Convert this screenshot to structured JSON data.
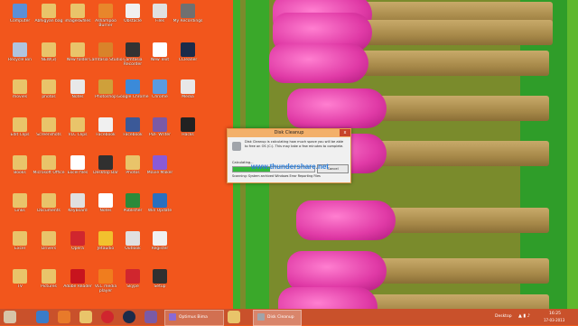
{
  "desktop": {
    "icons": [
      {
        "label": "Computer",
        "color": "#5a8fd6"
      },
      {
        "label": "Abhigyan bag",
        "color": "#e9c46a"
      },
      {
        "label": "images&files",
        "color": "#e9c46a"
      },
      {
        "label": "Ashampoo Burner",
        "color": "#e8862b"
      },
      {
        "label": "Obstacle",
        "color": "#f0f0f0"
      },
      {
        "label": "Files",
        "color": "#e0e0e0"
      },
      {
        "label": "My Recordings",
        "color": "#707070"
      },
      {
        "label": "Recycle Bin",
        "color": "#b0c4de"
      },
      {
        "label": "NEW(3)",
        "color": "#e9c46a"
      },
      {
        "label": "New folder",
        "color": "#e9c46a"
      },
      {
        "label": "Camtasia Studio",
        "color": "#d9832a"
      },
      {
        "label": "Camtasia Recorder",
        "color": "#333333"
      },
      {
        "label": "New Text",
        "color": "#ffffff"
      },
      {
        "label": "CCleaner",
        "color": "#1c2b4a"
      },
      {
        "label": "movies",
        "color": "#e9c46a"
      },
      {
        "label": "photos",
        "color": "#e9c46a"
      },
      {
        "label": "Notes",
        "color": "#e8e8e8"
      },
      {
        "label": "Photoshop",
        "color": "#cfa03a"
      },
      {
        "label": "Google Chrome",
        "color": "#3b8ad9"
      },
      {
        "label": "Chrome",
        "color": "#5b9be0"
      },
      {
        "label": "Media",
        "color": "#e8e8e8"
      },
      {
        "label": "Edit Clips",
        "color": "#e9c46a"
      },
      {
        "label": "Screenshots",
        "color": "#e9c46a"
      },
      {
        "label": "VLC Clips",
        "color": "#e9c46a"
      },
      {
        "label": "Facebook",
        "color": "#f0f0f0"
      },
      {
        "label": "Facebook",
        "color": "#3b5998"
      },
      {
        "label": "PDF Writer",
        "color": "#7b5aa6"
      },
      {
        "label": "Hacks",
        "color": "#222222"
      },
      {
        "label": "Books",
        "color": "#e9c46a"
      },
      {
        "label": "Microsoft Office",
        "color": "#e9c46a"
      },
      {
        "label": "Excel files",
        "color": "#ffffff"
      },
      {
        "label": "Desktop Bar",
        "color": "#303030"
      },
      {
        "label": "Photos",
        "color": "#e9c46a"
      },
      {
        "label": "Movie Maker",
        "color": "#8a5ad6"
      },
      {
        "label": "Links",
        "color": "#e9c46a"
      },
      {
        "label": "Documents",
        "color": "#e9c46a"
      },
      {
        "label": "Keyboard",
        "color": "#e0e0e0"
      },
      {
        "label": "Notes",
        "color": "#ffffff"
      },
      {
        "label": "Publisher",
        "color": "#2a8a3a"
      },
      {
        "label": "Win Update",
        "color": "#2a6fbf"
      },
      {
        "label": "Excel",
        "color": "#e9c46a"
      },
      {
        "label": "Drivers",
        "color": "#e9c46a"
      },
      {
        "label": "Opera",
        "color": "#d0262e"
      },
      {
        "label": "Jetaudio",
        "color": "#f2c12e"
      },
      {
        "label": "Outlook",
        "color": "#e0e0e0"
      },
      {
        "label": "Register",
        "color": "#f0f0f0"
      },
      {
        "label": "TV",
        "color": "#e9c46a"
      },
      {
        "label": "Pictures",
        "color": "#e9c46a"
      },
      {
        "label": "Adobe Reader",
        "color": "#c8141e"
      },
      {
        "label": "VLC media player",
        "color": "#f07d1e"
      },
      {
        "label": "Skype",
        "color": "#d0262e"
      },
      {
        "label": "Setup",
        "color": "#303030"
      }
    ]
  },
  "dialog": {
    "title": "Disk Cleanup",
    "close": "x",
    "message": "Disk Cleanup is calculating how much space you will be able to free on OS (C:). This may take a few minutes to complete.",
    "calculating": "Calculating...",
    "cancel": "Cancel",
    "progress": 0.45,
    "scanning": "Scanning:   System archived Windows Error Reporting Files"
  },
  "watermark": "www.thundershare.net",
  "taskbar": {
    "tasks": [
      "Optimus Bima",
      "Disk Cleanup"
    ],
    "desktop_label": "Desktop",
    "time": "16:25",
    "date": "17-03-2013"
  }
}
